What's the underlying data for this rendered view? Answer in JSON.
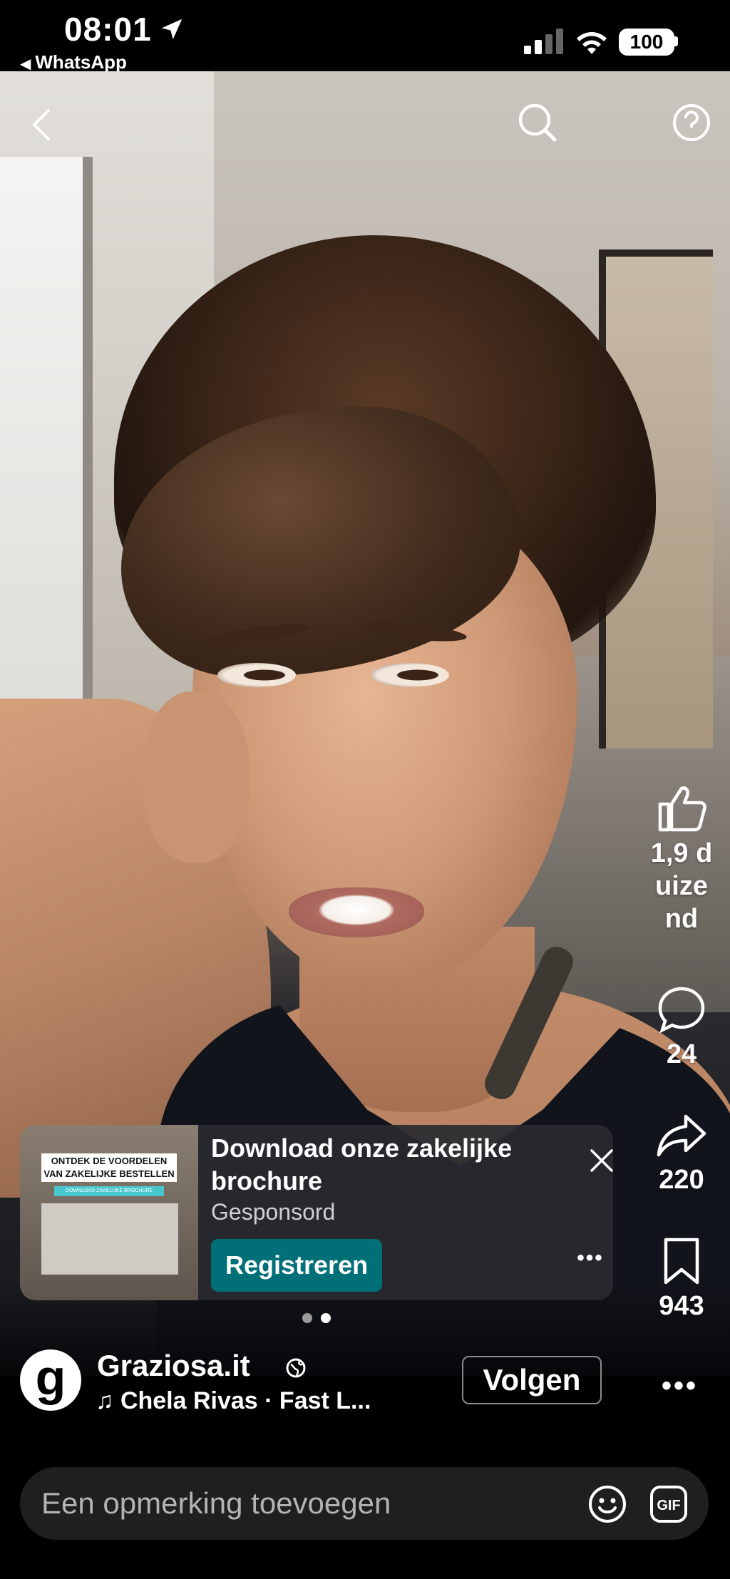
{
  "status_bar": {
    "time": "08:01",
    "back_app": "WhatsApp",
    "battery": "100"
  },
  "top_nav": {
    "back_icon": "chevron-left-icon",
    "search_icon": "search-icon",
    "help_icon": "question-icon"
  },
  "actions": {
    "like_count": "1,9 duizend",
    "comment_count": "24",
    "share_count": "220",
    "save_count": "943"
  },
  "ad": {
    "thumb_line1": "ONTDEK DE VOORDELEN",
    "thumb_line2": "VAN ZAKELIJKE BESTELLEN",
    "thumb_button": "DOWNLOAD ZAKELIJKE BROCHURE",
    "title": "Download onze zakelijke brochure",
    "sponsored": "Gesponsord",
    "cta": "Registreren"
  },
  "carousel": {
    "total": 2,
    "active": 2
  },
  "author": {
    "avatar_letter": "g",
    "name": "Graziosa.it",
    "music": "♫ Chela Rivas · Fast L...",
    "follow": "Volgen"
  },
  "comment": {
    "placeholder": "Een opmerking toevoegen"
  },
  "colors": {
    "cta": "#006f78",
    "background": "#000000",
    "comment_bg": "#1f1f20"
  }
}
